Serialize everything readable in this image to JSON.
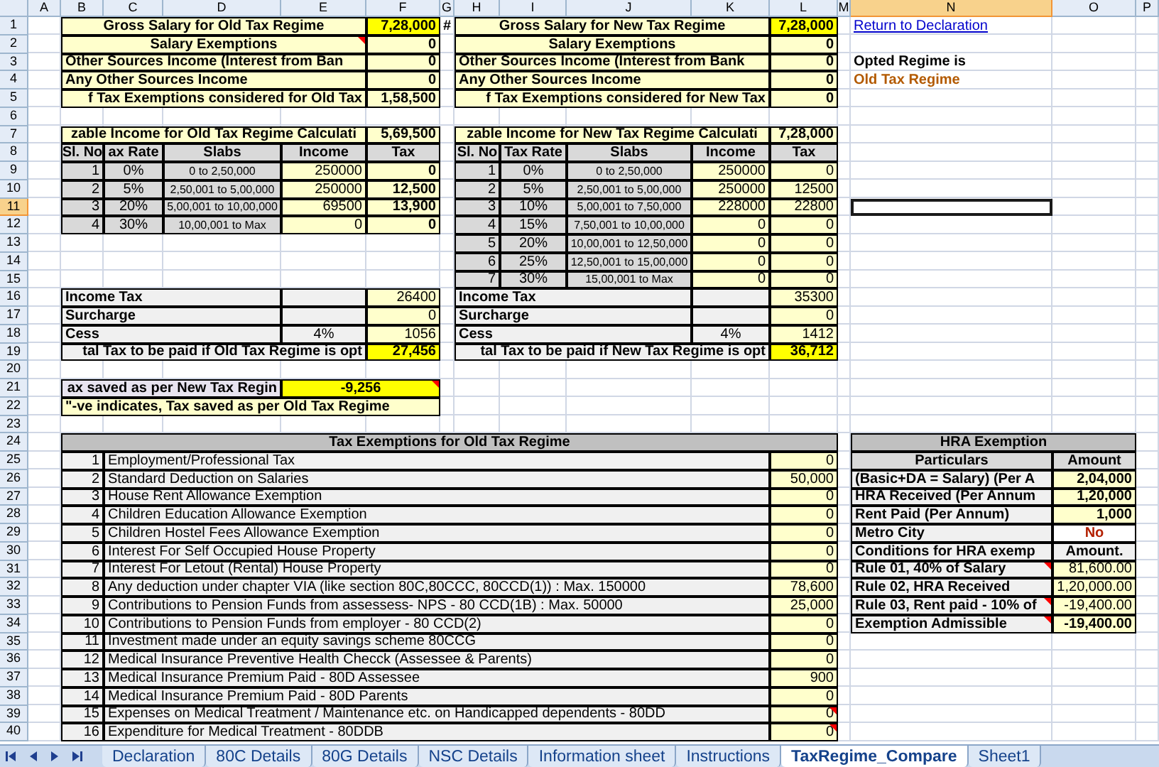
{
  "columns": [
    {
      "label": "A",
      "selected": false
    },
    {
      "label": "B",
      "selected": false
    },
    {
      "label": "C",
      "selected": false
    },
    {
      "label": "D",
      "selected": false
    },
    {
      "label": "E",
      "selected": false
    },
    {
      "label": "F",
      "selected": false
    },
    {
      "label": "G",
      "selected": false
    },
    {
      "label": "H",
      "selected": false
    },
    {
      "label": "I",
      "selected": false
    },
    {
      "label": "J",
      "selected": false
    },
    {
      "label": "K",
      "selected": false
    },
    {
      "label": "L",
      "selected": false
    },
    {
      "label": "M",
      "selected": false
    },
    {
      "label": "N",
      "selected": true
    },
    {
      "label": "O",
      "selected": false
    },
    {
      "label": "P",
      "selected": false
    }
  ],
  "rows": [
    {
      "label": "1",
      "selected": false
    },
    {
      "label": "2",
      "selected": false
    },
    {
      "label": "3",
      "selected": false
    },
    {
      "label": "4",
      "selected": false
    },
    {
      "label": "5",
      "selected": false
    },
    {
      "label": "6",
      "selected": false
    },
    {
      "label": "7",
      "selected": false
    },
    {
      "label": "8",
      "selected": false
    },
    {
      "label": "9",
      "selected": false
    },
    {
      "label": "10",
      "selected": false
    },
    {
      "label": "11",
      "selected": true
    },
    {
      "label": "12",
      "selected": false
    },
    {
      "label": "13",
      "selected": false
    },
    {
      "label": "14",
      "selected": false
    },
    {
      "label": "15",
      "selected": false
    },
    {
      "label": "16",
      "selected": false
    },
    {
      "label": "17",
      "selected": false
    },
    {
      "label": "18",
      "selected": false
    },
    {
      "label": "19",
      "selected": false
    },
    {
      "label": "20",
      "selected": false
    },
    {
      "label": "21",
      "selected": false
    },
    {
      "label": "22",
      "selected": false
    },
    {
      "label": "23",
      "selected": false
    },
    {
      "label": "24",
      "selected": false
    },
    {
      "label": "25",
      "selected": false
    },
    {
      "label": "26",
      "selected": false
    },
    {
      "label": "27",
      "selected": false
    },
    {
      "label": "28",
      "selected": false
    },
    {
      "label": "29",
      "selected": false
    },
    {
      "label": "30",
      "selected": false
    },
    {
      "label": "31",
      "selected": false
    },
    {
      "label": "32",
      "selected": false
    },
    {
      "label": "33",
      "selected": false
    },
    {
      "label": "34",
      "selected": false
    },
    {
      "label": "35",
      "selected": false
    },
    {
      "label": "36",
      "selected": false
    },
    {
      "label": "37",
      "selected": false
    },
    {
      "label": "38",
      "selected": false
    },
    {
      "label": "39",
      "selected": false
    },
    {
      "label": "40",
      "selected": false
    }
  ],
  "old_regime": {
    "summary": [
      {
        "label": "Gross Salary for Old Tax Regime",
        "value": "7,28,000",
        "highlight": true,
        "comment": false
      },
      {
        "label": "Salary Exemptions",
        "value": "0",
        "highlight": false,
        "comment": true
      },
      {
        "label": "Other Sources Income (Interest from Ban",
        "value": "0",
        "highlight": false,
        "comment": false
      },
      {
        "label": "Any Other Sources Income",
        "value": "0",
        "highlight": false,
        "comment": false
      },
      {
        "label": "f Tax Exemptions considered for Old Tax",
        "value": "1,58,500",
        "highlight": false,
        "comment": false
      }
    ],
    "marker": "#",
    "taxable": {
      "label": "zable Income for Old Tax Regime Calculati",
      "value": "5,69,500"
    },
    "headers": [
      "Sl. No",
      "ax Rate",
      "Slabs",
      "Income",
      "Tax"
    ],
    "slabs": [
      {
        "no": "1",
        "rate": "0%",
        "slab": "0 to 2,50,000",
        "income": "250000",
        "tax": "0"
      },
      {
        "no": "2",
        "rate": "5%",
        "slab": "2,50,001 to 5,00,000",
        "income": "250000",
        "tax": "12,500"
      },
      {
        "no": "3",
        "rate": "20%",
        "slab": "5,00,001 to 10,00,000",
        "income": "69500",
        "tax": "13,900"
      },
      {
        "no": "4",
        "rate": "30%",
        "slab": "10,00,001 to Max",
        "income": "0",
        "tax": "0"
      }
    ],
    "tax_bold": true,
    "tax_summary": [
      {
        "label": "Income Tax",
        "value": "26400"
      },
      {
        "label": "Surcharge",
        "value": "0"
      },
      {
        "label": "Cess",
        "rate": "4%",
        "value": "1056"
      }
    ],
    "total": {
      "label": "tal Tax to be paid if Old Tax Regime is opt",
      "value": "27,456"
    }
  },
  "new_regime": {
    "summary": [
      {
        "label": "Gross Salary for New Tax Regime",
        "value": "7,28,000",
        "highlight": true,
        "comment": false
      },
      {
        "label": "Salary Exemptions",
        "value": "0",
        "highlight": false,
        "comment": false
      },
      {
        "label": "Other Sources Income (Interest from Bank",
        "value": "0",
        "highlight": false,
        "comment": false
      },
      {
        "label": "Any Other Sources Income",
        "value": "0",
        "highlight": false,
        "comment": false
      },
      {
        "label": "f Tax Exemptions considered for New Tax",
        "value": "0",
        "highlight": false,
        "comment": false
      }
    ],
    "taxable": {
      "label": "zable Income for New Tax Regime Calculati",
      "value": "7,28,000"
    },
    "headers": [
      "Sl. No",
      "Tax Rate",
      "Slabs",
      "Income",
      "Tax"
    ],
    "slabs": [
      {
        "no": "1",
        "rate": "0%",
        "slab": "0 to 2,50,000",
        "income": "250000",
        "tax": "0"
      },
      {
        "no": "2",
        "rate": "5%",
        "slab": "2,50,001 to 5,00,000",
        "income": "250000",
        "tax": "12500"
      },
      {
        "no": "3",
        "rate": "10%",
        "slab": "5,00,001 to 7,50,000",
        "income": "228000",
        "tax": "22800"
      },
      {
        "no": "4",
        "rate": "15%",
        "slab": "7,50,001 to 10,00,000",
        "income": "0",
        "tax": "0"
      },
      {
        "no": "5",
        "rate": "20%",
        "slab": "10,00,001 to 12,50,000",
        "income": "0",
        "tax": "0"
      },
      {
        "no": "6",
        "rate": "25%",
        "slab": "12,50,001 to 15,00,000",
        "income": "0",
        "tax": "0"
      },
      {
        "no": "7",
        "rate": "30%",
        "slab": "15,00,001 to Max",
        "income": "0",
        "tax": "0"
      }
    ],
    "tax_bold": false,
    "tax_summary": [
      {
        "label": "Income Tax",
        "value": "35300"
      },
      {
        "label": "Surcharge",
        "value": "0"
      },
      {
        "label": "Cess",
        "rate": "4%",
        "value": "1412"
      }
    ],
    "total": {
      "label": "tal Tax to be paid if New Tax Regime is opt",
      "value": "36,712"
    }
  },
  "savings": {
    "label": "ax saved as per New Tax Regin",
    "value": "-9,256",
    "comment": true,
    "note": "\"-ve indicates, Tax saved as per Old Tax Regime"
  },
  "side": {
    "link": "Return to Declaration",
    "opted_label": "Opted Regime is",
    "opted_value": "Old Tax Regime"
  },
  "exemptions": {
    "title": "Tax Exemptions for Old Tax Regime",
    "rows": [
      {
        "no": "1",
        "label": "Employment/Professional Tax",
        "value": "0",
        "comment": false
      },
      {
        "no": "2",
        "label": "Standard Deduction on Salaries",
        "value": "50,000",
        "comment": false
      },
      {
        "no": "3",
        "label": "House Rent Allowance Exemption",
        "value": "0",
        "comment": false
      },
      {
        "no": "4",
        "label": "Children Education Allowance Exemption",
        "value": "0",
        "comment": false
      },
      {
        "no": "5",
        "label": "Children Hostel Fees Allowance Exemption",
        "value": "0",
        "comment": false
      },
      {
        "no": "6",
        "label": "Interest For Self Occupied House Property",
        "value": "0",
        "comment": false
      },
      {
        "no": "7",
        "label": "Interest For Letout (Rental) House Property",
        "value": "0",
        "comment": false
      },
      {
        "no": "8",
        "label": "Any deduction under chapter VIA (like section 80C,80CCC, 80CCD(1)) : Max. 150000",
        "value": "78,600",
        "comment": false
      },
      {
        "no": "9",
        "label": "Contributions to Pension Funds from assessess- NPS - 80 CCD(1B) :  Max. 50000",
        "value": "25,000",
        "comment": false
      },
      {
        "no": "10",
        "label": "Contributions to Pension Funds from employer - 80 CCD(2)",
        "value": "0",
        "comment": false
      },
      {
        "no": "11",
        "label": "Investment made under an equity savings scheme 80CCG",
        "value": "0",
        "comment": false
      },
      {
        "no": "12",
        "label": "Medical Insurance Preventive Health Checck (Assessee & Parents)",
        "value": "0",
        "comment": false
      },
      {
        "no": "13",
        "label": "Medical Insurance Premium Paid - 80D Assessee",
        "value": "900",
        "comment": false
      },
      {
        "no": "14",
        "label": "Medical Insurance Premium Paid - 80D Parents",
        "value": "0",
        "comment": false
      },
      {
        "no": "15",
        "label": "Expenses on Medical Treatment / Maintenance etc. on Handicapped dependents - 80DD",
        "value": "0",
        "comment": true
      },
      {
        "no": "16",
        "label": "Expenditure for Medical Treatment - 80DDB",
        "value": "0",
        "comment": true
      }
    ]
  },
  "hra": {
    "title": "HRA Exemption",
    "headers": [
      "Particulars",
      "Amount"
    ],
    "rows": [
      {
        "kind": "input",
        "label": "(Basic+DA = Salary)  (Per A",
        "value": "2,04,000",
        "comment": false
      },
      {
        "kind": "input",
        "label": "HRA  Received (Per Annum",
        "value": "1,20,000",
        "comment": false
      },
      {
        "kind": "input",
        "label": "Rent Paid (Per Annum)",
        "value": "1,000",
        "comment": false
      },
      {
        "kind": "choice",
        "label": "Metro City",
        "value": "No",
        "comment": false
      },
      {
        "kind": "subheader",
        "label": "Conditions for HRA exemp",
        "value": "Amount.",
        "comment": false
      },
      {
        "kind": "rule",
        "label": "Rule 01, 40% of Salary",
        "value": "81,600.00",
        "comment": true
      },
      {
        "kind": "rule",
        "label": "Rule 02, HRA Received",
        "value": "1,20,000.00",
        "comment": false
      },
      {
        "kind": "rule",
        "label": "Rule 03, Rent paid - 10% of",
        "value": "-19,400.00",
        "comment": true
      },
      {
        "kind": "result",
        "label": "Exemption Admissible",
        "value": "-19,400.00",
        "comment": true
      }
    ]
  },
  "sheet_tabs": [
    {
      "label": "Declaration",
      "selected": false
    },
    {
      "label": "80C Details",
      "selected": false
    },
    {
      "label": "80G Details",
      "selected": false
    },
    {
      "label": "NSC Details",
      "selected": false
    },
    {
      "label": "Information sheet",
      "selected": false
    },
    {
      "label": "Instructions",
      "selected": false
    },
    {
      "label": "TaxRegime_Compare",
      "selected": true
    },
    {
      "label": "Sheet1",
      "selected": false
    }
  ]
}
